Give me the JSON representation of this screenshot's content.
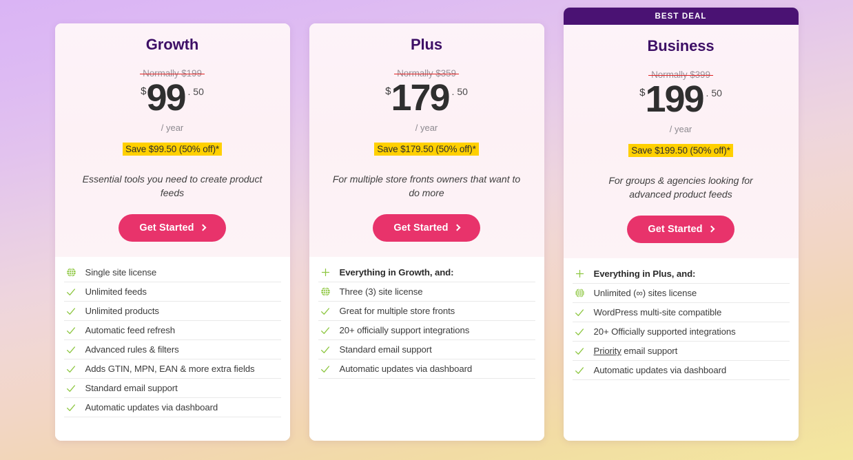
{
  "theme": {
    "accent_purple": "#4a1273",
    "cta_pink": "#e8336b",
    "highlight_yellow": "#ffd000",
    "check_green": "#8cc63f",
    "strike_red": "#e02020"
  },
  "plans": [
    {
      "name": "Growth",
      "badge": null,
      "normally": "Normally $199",
      "currency": "$",
      "amount": "99",
      "cents": ". 50",
      "period": "/ year",
      "save": "Save $99.50 (50% off)*",
      "tagline": "Essential tools you need to create product feeds",
      "cta_label": "Get Started",
      "features": [
        {
          "icon": "globe-icon",
          "text": "Single site license",
          "bold": false,
          "underline": null
        },
        {
          "icon": "check-icon",
          "text": "Unlimited feeds",
          "bold": false,
          "underline": null
        },
        {
          "icon": "check-icon",
          "text": "Unlimited products",
          "bold": false,
          "underline": null
        },
        {
          "icon": "check-icon",
          "text": "Automatic feed refresh",
          "bold": false,
          "underline": null
        },
        {
          "icon": "check-icon",
          "text": "Advanced rules & filters",
          "bold": false,
          "underline": null
        },
        {
          "icon": "check-icon",
          "text": "Adds GTIN, MPN, EAN & more extra fields",
          "bold": false,
          "underline": null
        },
        {
          "icon": "check-icon",
          "text": "Standard email support",
          "bold": false,
          "underline": null
        },
        {
          "icon": "check-icon",
          "text": "Automatic updates via dashboard",
          "bold": false,
          "underline": null
        }
      ]
    },
    {
      "name": "Plus",
      "badge": null,
      "normally": "Normally $359",
      "currency": "$",
      "amount": "179",
      "cents": ". 50",
      "period": "/ year",
      "save": "Save $179.50 (50% off)*",
      "tagline": "For multiple store fronts owners that want to do more",
      "cta_label": "Get Started",
      "features": [
        {
          "icon": "plus-icon",
          "text": "Everything in Growth, and:",
          "bold": true,
          "underline": null
        },
        {
          "icon": "globe-icon",
          "text": "Three (3) site license",
          "bold": false,
          "underline": null
        },
        {
          "icon": "check-icon",
          "text": "Great for multiple store fronts",
          "bold": false,
          "underline": null
        },
        {
          "icon": "check-icon",
          "text": "20+ officially support integrations",
          "bold": false,
          "underline": null
        },
        {
          "icon": "check-icon",
          "text": "Standard email support",
          "bold": false,
          "underline": null
        },
        {
          "icon": "check-icon",
          "text": "Automatic updates via dashboard",
          "bold": false,
          "underline": null
        }
      ]
    },
    {
      "name": "Business",
      "badge": "BEST DEAL",
      "normally": "Normally $399",
      "currency": "$",
      "amount": "199",
      "cents": ". 50",
      "period": "/ year",
      "save": "Save $199.50 (50% off)*",
      "tagline": "For groups & agencies looking for advanced product feeds",
      "cta_label": "Get Started",
      "features": [
        {
          "icon": "plus-icon",
          "text": "Everything in Plus, and:",
          "bold": true,
          "underline": null
        },
        {
          "icon": "globe-icon",
          "text": "Unlimited (∞) sites license",
          "bold": false,
          "underline": null
        },
        {
          "icon": "check-icon",
          "text": "WordPress multi-site compatible",
          "bold": false,
          "underline": null
        },
        {
          "icon": "check-icon",
          "text": "20+ Officially supported integrations",
          "bold": false,
          "underline": null
        },
        {
          "icon": "check-icon",
          "text": "Priority email support",
          "bold": false,
          "underline": "Priority"
        },
        {
          "icon": "check-icon",
          "text": "Automatic updates via dashboard",
          "bold": false,
          "underline": null
        }
      ]
    }
  ]
}
